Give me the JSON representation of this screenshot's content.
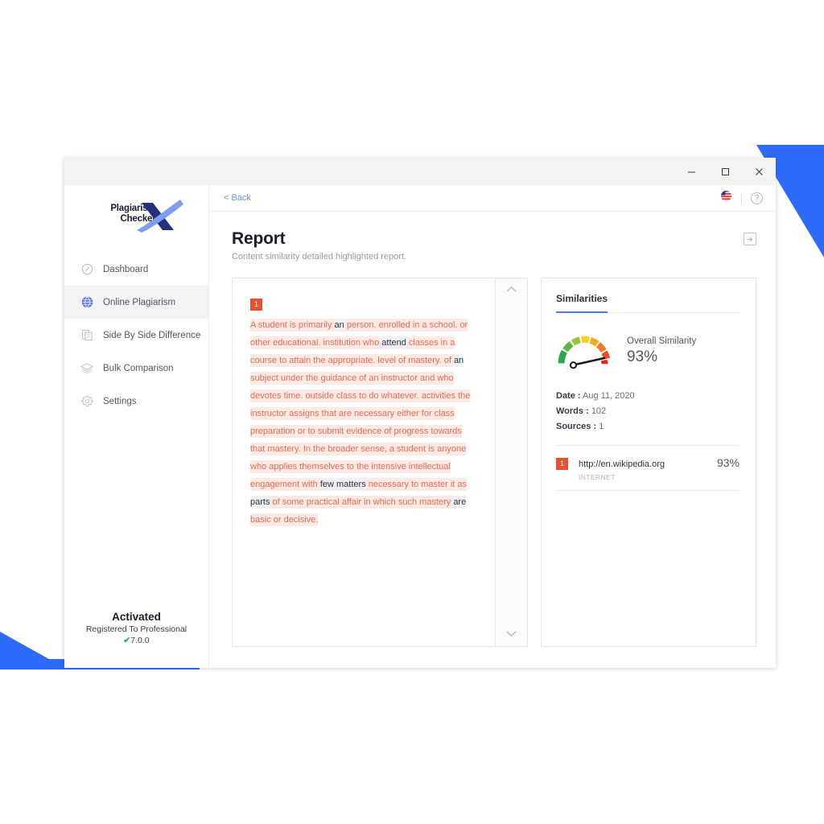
{
  "window": {
    "controls": [
      {
        "name": "minimize",
        "glyph": "─"
      },
      {
        "name": "maximize",
        "glyph": "☐"
      },
      {
        "name": "close",
        "glyph": "✕"
      }
    ]
  },
  "sidebar": {
    "logo": {
      "line1": "Plagiarism",
      "line2": "Checker",
      "mark": "X"
    },
    "items": [
      {
        "label": "Dashboard",
        "icon": "gauge-icon",
        "active": false
      },
      {
        "label": "Online Plagiarism",
        "icon": "globe-icon",
        "active": true
      },
      {
        "label": "Side By Side Difference",
        "icon": "documents-icon",
        "active": false
      },
      {
        "label": "Bulk Comparison",
        "icon": "layers-icon",
        "active": false
      },
      {
        "label": "Settings",
        "icon": "gear-icon",
        "active": false
      }
    ],
    "activation": {
      "title": "Activated",
      "subtitle": "Registered To Professional",
      "check": "✔",
      "version": "7.0.0"
    }
  },
  "topbar": {
    "back_label": "< Back",
    "language_icon": "us-flag-icon",
    "help_icon": "help-circle-icon"
  },
  "page": {
    "title": "Report",
    "subtitle": "Content similarity detailed highlighted report.",
    "export_icon": "export-icon"
  },
  "document": {
    "badge": "1",
    "segments": [
      {
        "text": "A student is primarily ",
        "kind": "hl"
      },
      {
        "text": "an",
        "kind": "plain"
      },
      {
        "text": " person. enrolled in a school. or other educational. institution who ",
        "kind": "hl"
      },
      {
        "text": "attend",
        "kind": "plain"
      },
      {
        "text": " classes in a course to attain the appropriate. level of mastery. of ",
        "kind": "hl"
      },
      {
        "text": "an",
        "kind": "plain"
      },
      {
        "text": " subject under the guidance of an instructor and who devotes time. outside class to do whatever. activities the instructor assigns that are necessary either for class preparation or to submit evidence of progress towards that mastery. In the broader sense, a student is anyone who applies themselves to the intensive intellectual engagement with ",
        "kind": "hl"
      },
      {
        "text": "few matters",
        "kind": "plain"
      },
      {
        "text": " necessary to master it as ",
        "kind": "hl"
      },
      {
        "text": "parts",
        "kind": "plain"
      },
      {
        "text": " of some practical affair in which such mastery ",
        "kind": "hl"
      },
      {
        "text": "are",
        "kind": "plain"
      },
      {
        "text": " basic or decisive.",
        "kind": "hl"
      }
    ],
    "scroll_up": "⌃",
    "scroll_down": "⌄"
  },
  "similarities": {
    "tab_label": "Similarities",
    "gauge": {
      "label": "Overall Similarity",
      "value": "93%",
      "percent": 93,
      "colors": [
        "#2aa84a",
        "#5cb646",
        "#9ac63f",
        "#cfd631",
        "#f4d020",
        "#f7a81b",
        "#f47c1b",
        "#ef4b23",
        "#e8231b"
      ]
    },
    "meta": [
      {
        "label": "Date :",
        "value": "Aug 11, 2020"
      },
      {
        "label": "Words :",
        "value": "102"
      },
      {
        "label": "Sources :",
        "value": "1"
      }
    ],
    "sources": [
      {
        "badge": "1",
        "url": "http://en.wikipedia.org",
        "type": "INTERNET",
        "percent": "93%"
      }
    ]
  },
  "theme": {
    "accent_blue": "#2f6bfa",
    "tab_underline": "#4a7cf5",
    "highlight_text": "#ef6a52",
    "highlight_bg": "#fdeae5",
    "badge_bg": "#e8512e",
    "activation_check": "#15b36a"
  }
}
